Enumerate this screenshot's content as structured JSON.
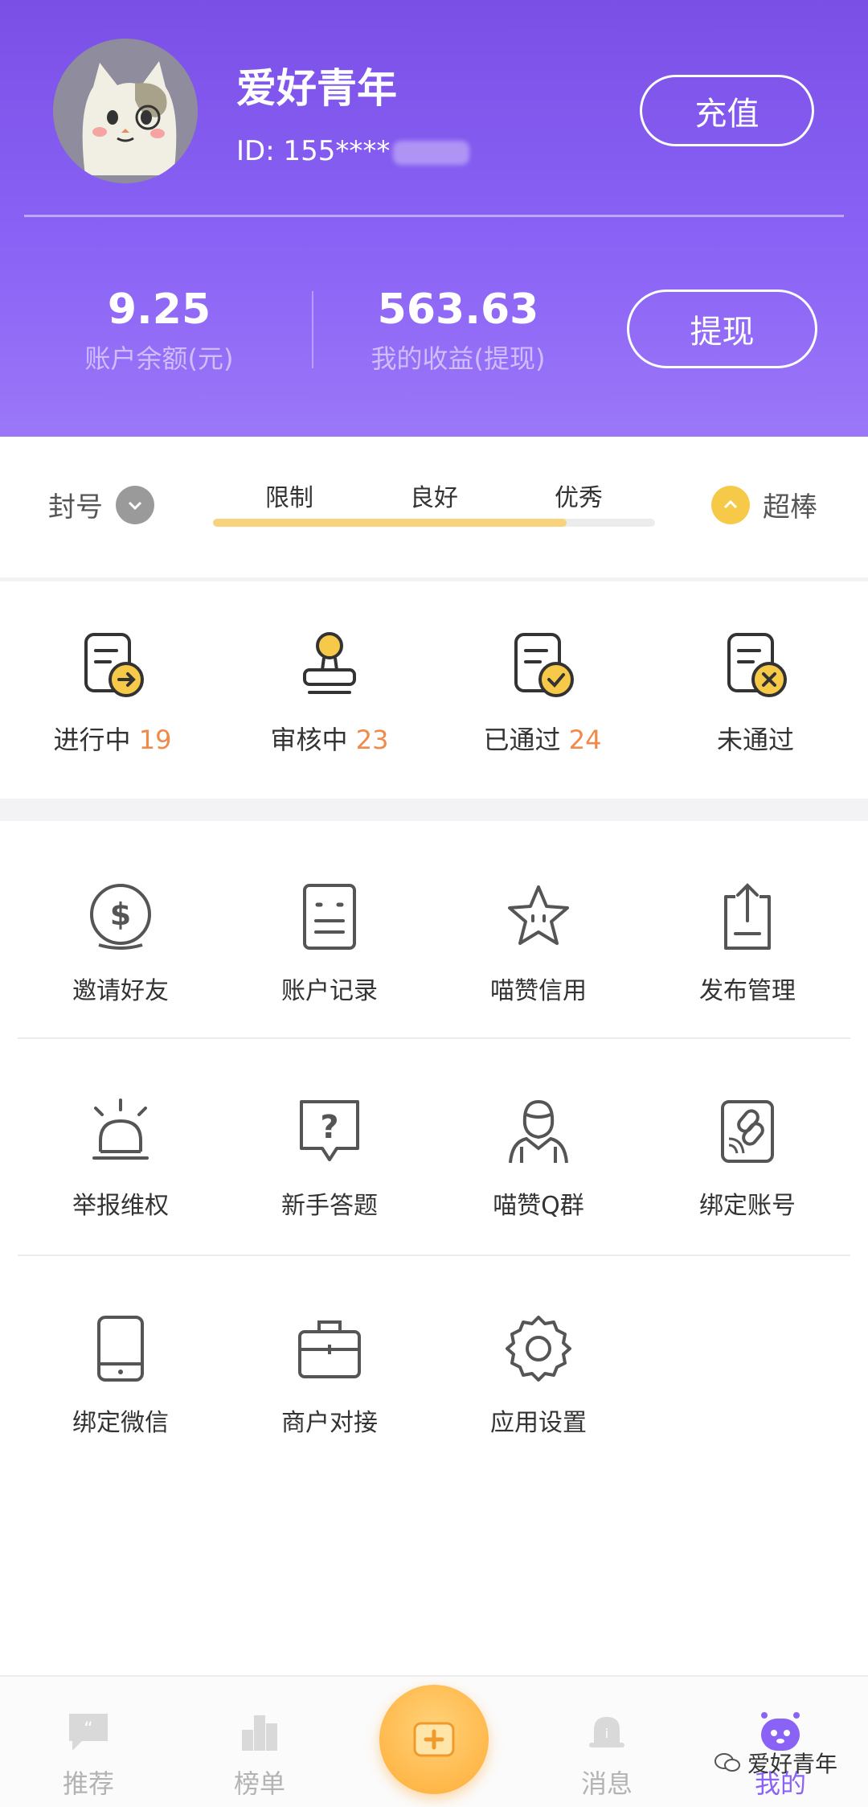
{
  "profile": {
    "name": "爱好青年",
    "id": "ID: 155****",
    "recharge_label": "充值",
    "withdraw_label": "提现"
  },
  "stats": {
    "balance_value": "9.25",
    "balance_label": "账户余额(元)",
    "income_value": "563.63",
    "income_label": "我的收益(提现)"
  },
  "credit": {
    "left_label": "封号",
    "marks": [
      "限制",
      "良好",
      "优秀"
    ],
    "right_label": "超棒",
    "progress": 0.8
  },
  "tasks": [
    {
      "label": "进行中",
      "count": "19",
      "icon": "doc-arrow-icon"
    },
    {
      "label": "审核中",
      "count": "23",
      "icon": "stamp-icon"
    },
    {
      "label": "已通过",
      "count": "24",
      "icon": "doc-check-icon"
    },
    {
      "label": "未通过",
      "count": "",
      "icon": "doc-cross-icon"
    }
  ],
  "grid": [
    {
      "label": "邀请好友",
      "icon": "coin-dollar-icon"
    },
    {
      "label": "账户记录",
      "icon": "record-list-icon"
    },
    {
      "label": "喵赞信用",
      "icon": "star-icon"
    },
    {
      "label": "发布管理",
      "icon": "upload-icon"
    },
    {
      "label": "举报维权",
      "icon": "alarm-icon"
    },
    {
      "label": "新手答题",
      "icon": "question-icon"
    },
    {
      "label": "喵赞Q群",
      "icon": "qq-person-icon"
    },
    {
      "label": "绑定账号",
      "icon": "link-card-icon"
    },
    {
      "label": "绑定微信",
      "icon": "phone-icon"
    },
    {
      "label": "商户对接",
      "icon": "briefcase-icon"
    },
    {
      "label": "应用设置",
      "icon": "gear-icon"
    }
  ],
  "nav": {
    "items": [
      {
        "label": "推荐",
        "icon": "chat-bubble-icon"
      },
      {
        "label": "榜单",
        "icon": "podium-icon"
      },
      {
        "label": "消息",
        "icon": "bell-icon"
      },
      {
        "label": "我的",
        "icon": "robot-icon"
      }
    ],
    "center_icon": "add-icon"
  },
  "watermark": "爱好青年",
  "colors": {
    "header_top": "#7a4fe6",
    "header_bottom": "#9b77f8",
    "accent_orange": "#ef8a4b",
    "icon_yellow": "#f7c948",
    "nav_active": "#8a62f5"
  }
}
